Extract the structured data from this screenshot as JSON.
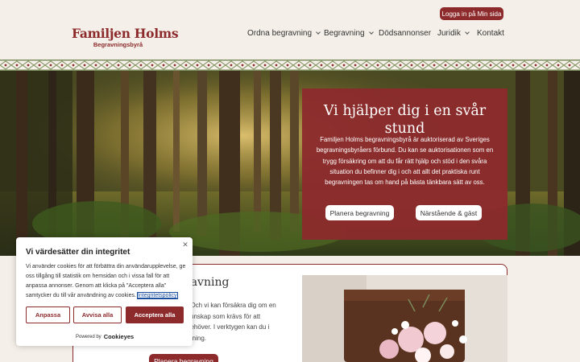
{
  "header": {
    "login_label": "Logga in på Min sida",
    "logo_name": "Familjen Holms",
    "logo_sub": "Begravningsbyrå",
    "nav": [
      {
        "label": "Ordna begravning",
        "dropdown": true
      },
      {
        "label": "Begravning",
        "dropdown": true
      },
      {
        "label": "Dödsannonser",
        "dropdown": false
      },
      {
        "label": "Juridik",
        "dropdown": true
      },
      {
        "label": "Kontakt",
        "dropdown": false
      }
    ]
  },
  "hero": {
    "title": "Vi hjälper dig i en svår stund",
    "text": "Familjen Holms begravningsbyrå är auktoriserad av Sveriges begravningsbyråers förbund. Du kan se auktorisationen som en trygg försäkring om att du får rätt hjälp och stöd i den svåra situation du befinner dig i och att allt det praktiska runt begravningen tas om hand på bästa tänkbara sätt av oss.",
    "button_primary": "Planera begravning",
    "button_secondary": "Närstående & gäst"
  },
  "section": {
    "title": "ravning",
    "text": ". Och vi kan försäkra dig om en kunskap som krävs för att behöver. I verktygen kan du i rvning.",
    "button": "Planera begravning"
  },
  "cookie": {
    "title": "Vi värdesätter din integritet",
    "text": "Vi använder cookies för att förbättra din användarupplevelse, ge oss tillgång till statistik om hemsidan och i vissa fall för att anpassa annonser. Genom att klicka på \"Acceptera alla\" samtycker du till vår användning av cookies.",
    "link": "Integritetspolicy",
    "btn_customize": "Anpassa",
    "btn_reject": "Avvisa alla",
    "btn_accept": "Acceptera alla",
    "powered_by": "Powered by",
    "brand": "Cookieyes"
  },
  "colors": {
    "brand": "#8c2a2c",
    "background": "#f4efe8"
  },
  "icons": [
    "chevron-down-icon",
    "close-icon"
  ]
}
